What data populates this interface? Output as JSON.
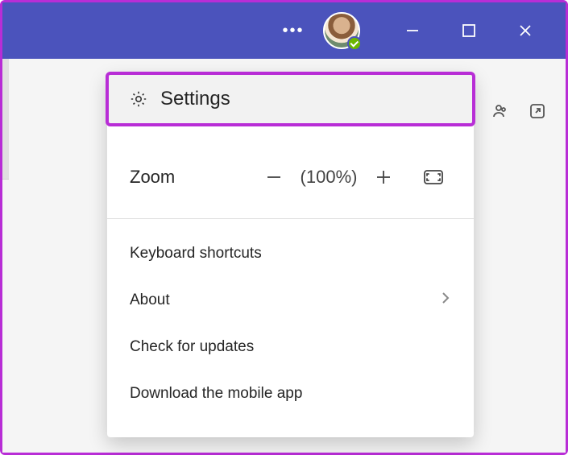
{
  "titlebar": {
    "ellipsis": "•••"
  },
  "presence_status": "available",
  "menu": {
    "settings_label": "Settings",
    "zoom_label": "Zoom",
    "zoom_value": "(100%)",
    "keyboard_shortcuts": "Keyboard shortcuts",
    "about": "About",
    "check_updates": "Check for updates",
    "download_app": "Download the mobile app"
  },
  "colors": {
    "brand": "#4b53bc",
    "highlight": "#b82dd6",
    "presence": "#6bb700"
  }
}
